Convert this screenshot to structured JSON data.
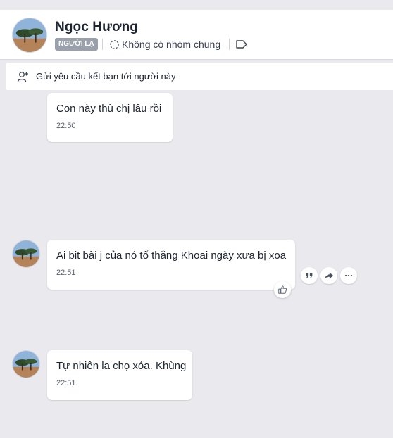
{
  "header": {
    "contact_name": "Ngọc Hương",
    "stranger_badge": "NGƯỜI LẠ",
    "common_groups": "Không có nhóm chung",
    "group_icon": "dashed-circle-icon",
    "tag_icon": "label-tag-icon"
  },
  "friend_request": {
    "label": "Gửi yêu cầu kết bạn tới người này",
    "icon": "add-user-icon"
  },
  "messages": [
    {
      "text": "Con này thù chị lâu rồi",
      "time": "22:50"
    },
    {
      "text": "Ai bit bài j của nó tố thằng Khoai ngày xưa bị xoa",
      "time": "22:51"
    },
    {
      "text": "Tự nhiên la chọ xóa. Khùng",
      "time": "22:51"
    }
  ],
  "message_actions": [
    "quote-icon",
    "share-icon",
    "more-icon"
  ],
  "reaction_icon": "thumbs-up-icon",
  "colors": {
    "background": "#e9e9ee",
    "bubble": "#ffffff",
    "badge": "#9aa1ab",
    "text": "#1d2430"
  }
}
